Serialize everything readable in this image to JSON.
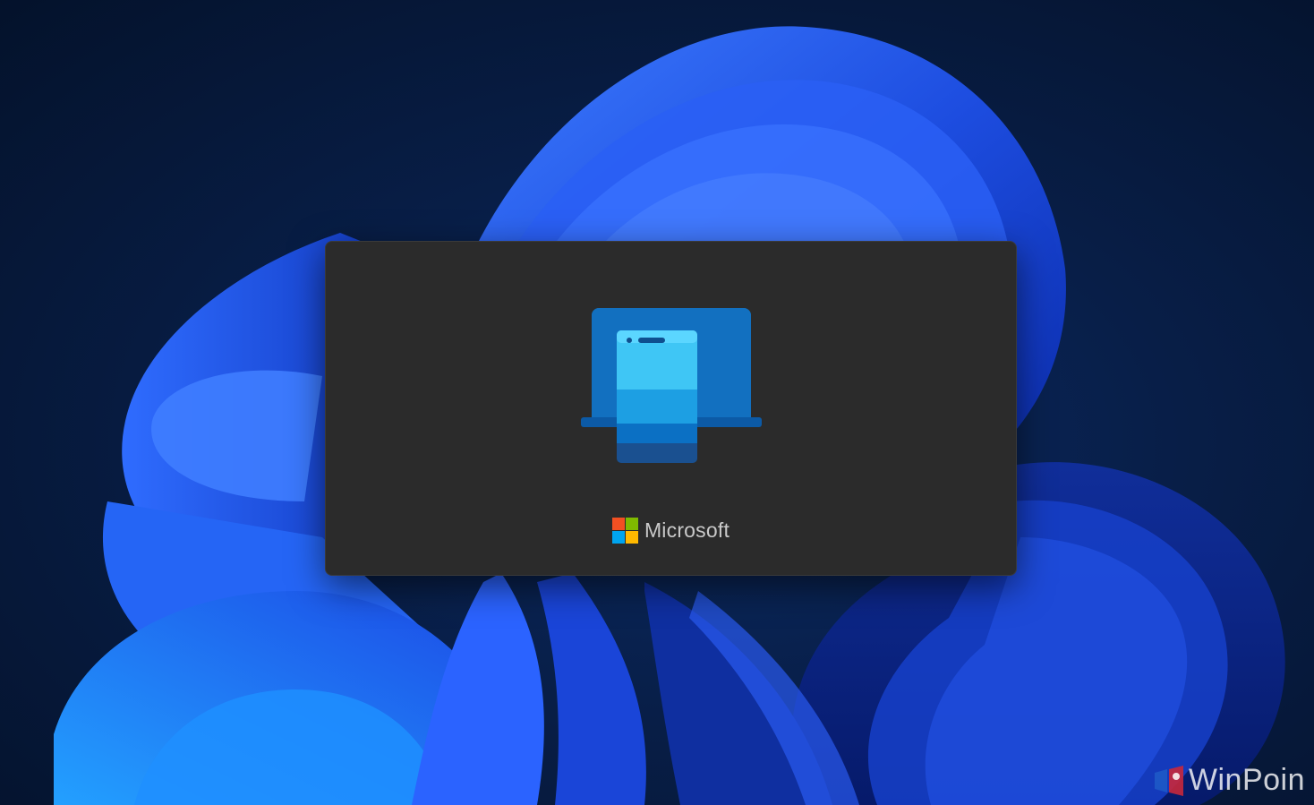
{
  "splash": {
    "app_icon": "phone-link-icon",
    "brand_text": "Microsoft",
    "brand_logo": "microsoft-logo-icon",
    "logo_colors": [
      "#f25022",
      "#7fba00",
      "#00a4ef",
      "#ffb900"
    ]
  },
  "watermark": {
    "text": "WinPoin",
    "icon": "winpoin-logo-icon"
  },
  "colors": {
    "splash_bg": "#2b2b2b",
    "wallpaper_bloom": "#1f5cff"
  }
}
